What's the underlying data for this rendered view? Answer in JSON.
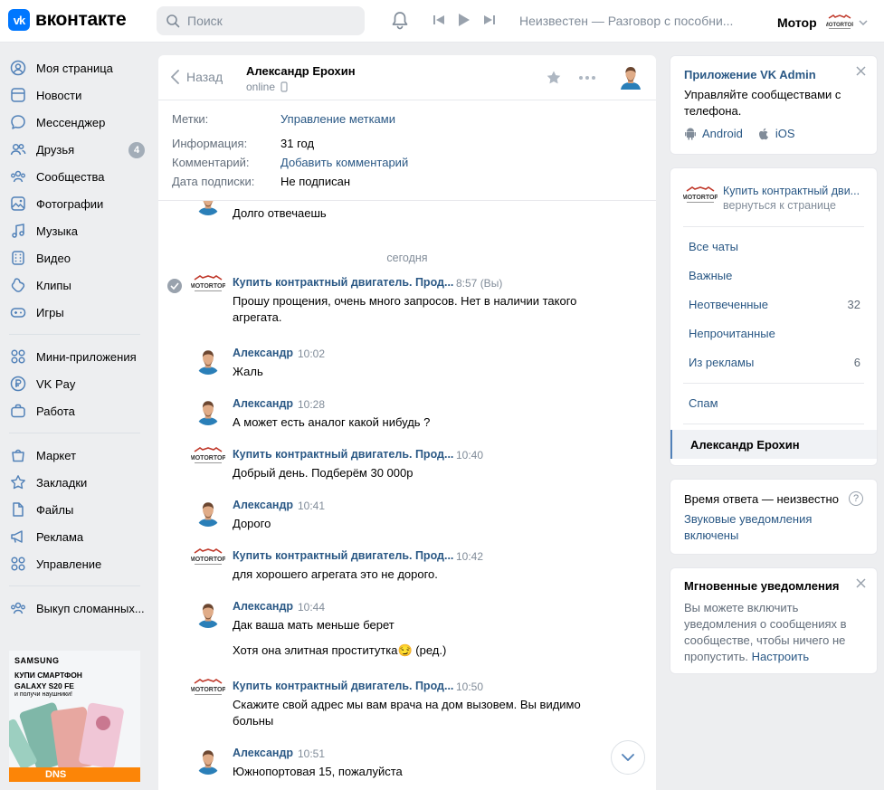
{
  "brand": {
    "mark": "vk",
    "name": "вконтакте",
    "accent": "#0077ff"
  },
  "search": {
    "placeholder": "Поиск"
  },
  "player": {
    "track": "Неизвестен — Разговор с пособни..."
  },
  "profile": {
    "name": "Мотор"
  },
  "sidebar": {
    "items": [
      {
        "label": "Моя страница",
        "icon": "user-circle-icon"
      },
      {
        "label": "Новости",
        "icon": "newsfeed-icon"
      },
      {
        "label": "Мессенджер",
        "icon": "message-icon"
      },
      {
        "label": "Друзья",
        "icon": "users-icon",
        "badge": "4"
      },
      {
        "label": "Сообщества",
        "icon": "communities-icon"
      },
      {
        "label": "Фотографии",
        "icon": "photos-icon"
      },
      {
        "label": "Музыка",
        "icon": "music-icon"
      },
      {
        "label": "Видео",
        "icon": "video-icon"
      },
      {
        "label": "Клипы",
        "icon": "clips-icon"
      },
      {
        "label": "Игры",
        "icon": "games-icon"
      },
      {
        "label": "Мини-приложения",
        "icon": "apps-icon"
      },
      {
        "label": "VK Pay",
        "icon": "vkpay-icon"
      },
      {
        "label": "Работа",
        "icon": "work-icon"
      },
      {
        "label": "Маркет",
        "icon": "market-icon"
      },
      {
        "label": "Закладки",
        "icon": "bookmark-icon"
      },
      {
        "label": "Файлы",
        "icon": "files-icon"
      },
      {
        "label": "Реклама",
        "icon": "ads-icon"
      },
      {
        "label": "Управление",
        "icon": "manage-icon"
      },
      {
        "label": "Выкуп сломанных...",
        "icon": "group-icon"
      }
    ],
    "ad": {
      "brand": "SAMSUNG",
      "line1": "КУПИ СМАРТФОН",
      "line2": "GALAXY S20 FE",
      "line3": "и получи наушники!",
      "store": "DNS"
    }
  },
  "chat": {
    "back_label": "Назад",
    "name": "Александр Ерохин",
    "status": "online",
    "info": {
      "tags_key": "Метки:",
      "tags_val": "Управление метками",
      "info_key": "Информация:",
      "info_val": "31 год",
      "comment_key": "Комментарий:",
      "comment_val": "Добавить комментарий",
      "sub_key": "Дата подписки:",
      "sub_val": "Не подписан"
    },
    "top_partial_text": "Долго отвечаешь",
    "date_separator": "сегодня",
    "messages": [
      {
        "author": "Купить контрактный двигатель. Прод...",
        "time": "8:57 (Вы)",
        "text": "Прошу прощения, очень много запросов. Нет в наличии такого агрегата.",
        "group": true
      },
      {
        "author": "Александр",
        "time": "10:02",
        "text": "Жаль",
        "group": false
      },
      {
        "author": "Александр",
        "time": "10:28",
        "text": "А может есть аналог какой нибудь ?",
        "group": false
      },
      {
        "author": "Купить контрактный двигатель. Прод...",
        "time": "10:40",
        "text": "Добрый день. Подберём 30 000р",
        "group": true
      },
      {
        "author": "Александр",
        "time": "10:41",
        "text": "Дорого",
        "group": false
      },
      {
        "author": "Купить контрактный двигатель. Прод...",
        "time": "10:42",
        "text": "для хорошего агрегата это не дорого.",
        "group": true
      },
      {
        "author": "Александр",
        "time": "10:44",
        "text": "Дак ваша мать меньше берет",
        "group": false
      },
      {
        "author": "",
        "time": "",
        "text": "Хотя она элитная проститутка😏 (ред.)",
        "group": false
      },
      {
        "author": "Купить контрактный двигатель. Прод...",
        "time": "10:50",
        "text": "Скажите свой адрес мы вам врача на дом вызовем. Вы видимо больны",
        "group": true
      },
      {
        "author": "Александр",
        "time": "10:51",
        "text": "Южнопортовая 15, пожалуйста",
        "group": false
      }
    ]
  },
  "right": {
    "vkadmin": {
      "title": "Приложение VK Admin",
      "text": "Управляйте сообществами с телефона.",
      "android": "Android",
      "ios": "iOS"
    },
    "group": {
      "title": "Купить контрактный дви...",
      "subtitle": "вернуться к странице"
    },
    "filters": [
      {
        "label": "Все чаты",
        "count": ""
      },
      {
        "label": "Важные",
        "count": ""
      },
      {
        "label": "Неотвеченные",
        "count": "32"
      },
      {
        "label": "Непрочитанные",
        "count": ""
      },
      {
        "label": "Из рекламы",
        "count": "6"
      },
      {
        "label": "Спам",
        "count": ""
      }
    ],
    "active_chat": "Александр Ерохин",
    "response": {
      "label": "Время ответа — неизвестно",
      "help": "?",
      "sound": "Звуковые уведомления включены"
    },
    "instant": {
      "title": "Мгновенные уведомления",
      "text": "Вы можете включить уведомления о сообщениях в сообществе, чтобы ничего не пропустить.",
      "link": "Настроить"
    }
  }
}
